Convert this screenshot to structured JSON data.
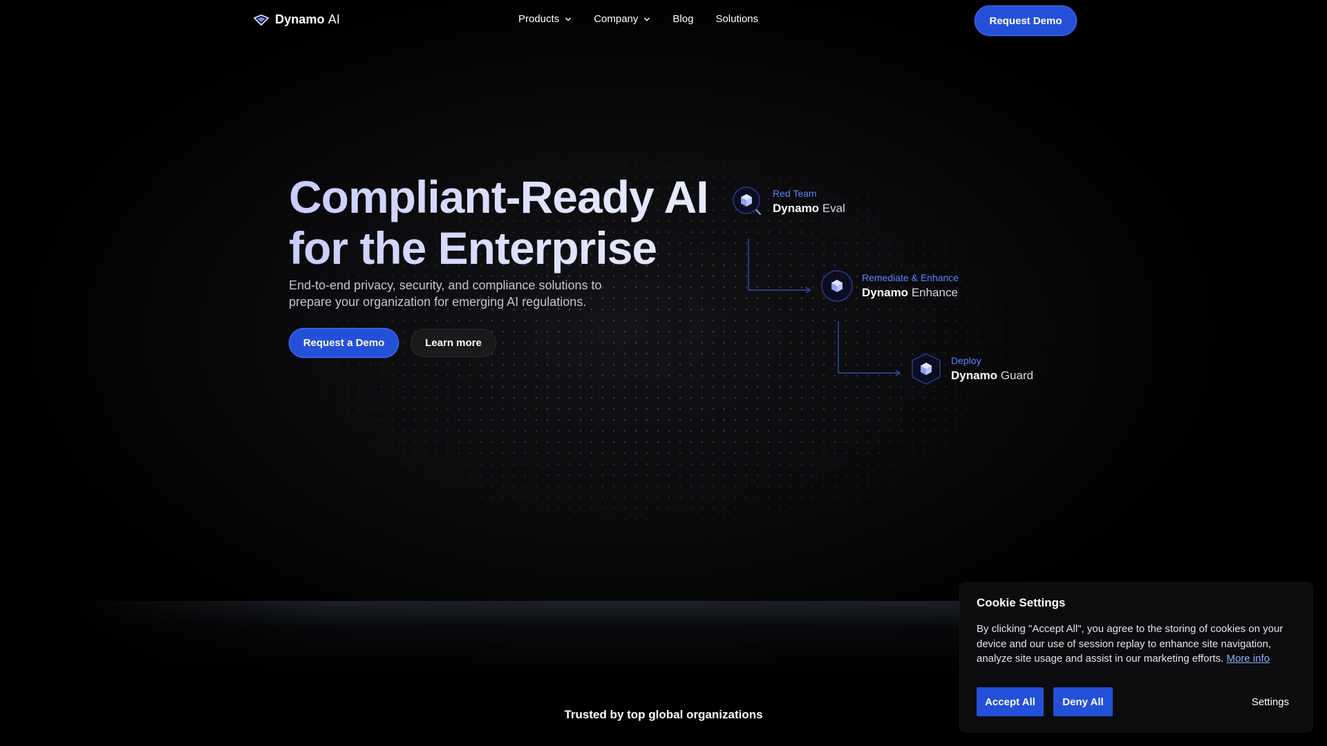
{
  "brand": {
    "name_bold": "Dynamo",
    "name_thin": "AI",
    "logo_icon": "dynamo-logo-icon"
  },
  "nav": {
    "items": [
      {
        "label": "Products",
        "has_dropdown": true
      },
      {
        "label": "Company",
        "has_dropdown": true
      },
      {
        "label": "Blog",
        "has_dropdown": false
      },
      {
        "label": "Solutions",
        "has_dropdown": false
      }
    ],
    "cta_label": "Request Demo"
  },
  "hero": {
    "title_line1": "Compliant-Ready AI",
    "title_line2": "for the Enterprise",
    "subtitle_line1": "End-to-end privacy, security, and compliance solutions to",
    "subtitle_line2": "prepare your organization for emerging AI regulations.",
    "primary_cta": "Request a Demo",
    "secondary_cta": "Learn more"
  },
  "flow": {
    "nodes": [
      {
        "stage": "Red Team",
        "brand": "Dynamo",
        "product": "Eval",
        "icon": "cube-search-icon"
      },
      {
        "stage": "Remediate & Enhance",
        "brand": "Dynamo",
        "product": "Enhance",
        "icon": "cube-circle-icon"
      },
      {
        "stage": "Deploy",
        "brand": "Dynamo",
        "product": "Guard",
        "icon": "cube-shield-icon"
      }
    ]
  },
  "trusted": {
    "label": "Trusted by top global organizations"
  },
  "cookie": {
    "title": "Cookie Settings",
    "body": "By clicking \"Accept All\", you agree to the storing of cookies on your device and our use of session replay to enhance site navigation, analyze site usage and assist in our marketing efforts.",
    "more_info": "More info",
    "accept_label": "Accept All",
    "deny_label": "Deny All",
    "settings_label": "Settings"
  },
  "colors": {
    "accent": "#2450d8",
    "link": "#5a82ff",
    "background": "#000000"
  }
}
